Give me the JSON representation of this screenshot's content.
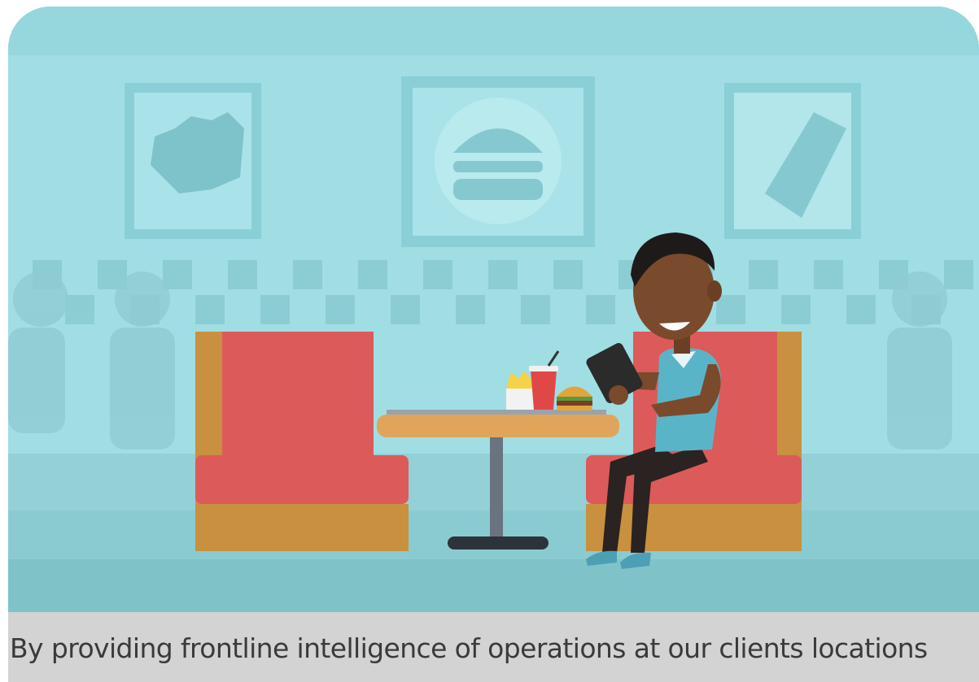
{
  "caption": {
    "text": "By providing frontline intelligence of operations at our clients locations"
  },
  "icons": [
    "fries-poster-icon",
    "burger-poster-icon",
    "drink-poster-icon",
    "person-with-phone-icon",
    "burger-icon",
    "fries-icon",
    "soda-cup-icon"
  ],
  "colors": {
    "wall": "#9fdde3",
    "booth_red": "#dd5a5a",
    "booth_wood": "#c8903f",
    "table_top": "#e0a55b",
    "floor": "#8fcdd2",
    "shirt": "#5ab4c8",
    "caption_bar": "#d3d3d3",
    "caption_text": "#3a3a3a"
  }
}
